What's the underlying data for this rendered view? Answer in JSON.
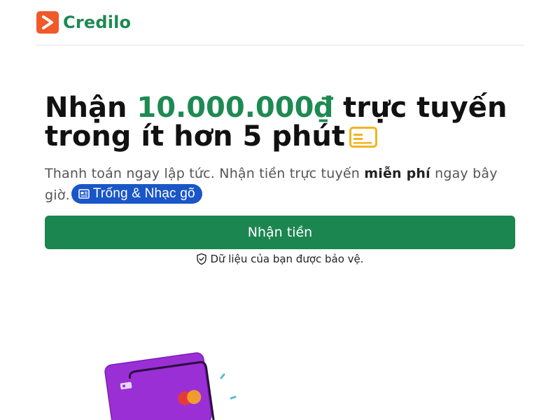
{
  "brand": {
    "name": "Credilo",
    "colors": {
      "primary": "#1e8a53",
      "logo_mark": "#f0592a",
      "pill": "#1a56c7"
    }
  },
  "hero": {
    "headline_prefix": "Nhận ",
    "headline_amount": "10.000.000₫",
    "headline_rest": " trực tuyến trong ít hơn 5 phút",
    "headline_icon": "card-icon",
    "subtext_before": "Thanh toán ngay lập tức. Nhận tiền trực tuyến ",
    "subtext_emphasis": "miễn phí",
    "subtext_after": " ngay bây giờ.",
    "pill_label": "Trống & Nhạc gõ",
    "pill_icon": "news-icon"
  },
  "cta": {
    "label": "Nhận tiền"
  },
  "security": {
    "text": "Dữ liệu của bạn được bảo vệ.",
    "icon": "shield-check-icon"
  },
  "illustration": {
    "icon": "credit-card-illustration"
  }
}
